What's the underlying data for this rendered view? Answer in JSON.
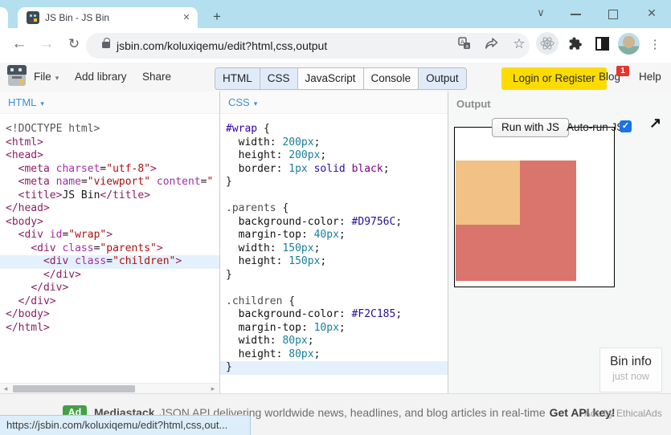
{
  "browser": {
    "tab_title": "JS Bin - JS Bin",
    "url": "jsbin.com/koluxiqemu/edit?html,css,output",
    "status_url": "https://jsbin.com/koluxiqemu/edit?html,css,out..."
  },
  "icons": {
    "caret": "▾",
    "star": "☆",
    "back": "←",
    "forward": "→",
    "reload": "↻",
    "dots": "⋮",
    "chevron": "∨",
    "close": "✕",
    "tab_close": "✕",
    "plus": "+",
    "expand": "↗",
    "check": "✓",
    "scroll_left": "◂",
    "scroll_right": "▸"
  },
  "jsbin": {
    "menu": [
      "File",
      "Add library",
      "Share"
    ],
    "tabs": [
      {
        "label": "HTML",
        "active": true
      },
      {
        "label": "CSS",
        "active": true
      },
      {
        "label": "JavaScript",
        "active": false
      },
      {
        "label": "Console",
        "active": false
      },
      {
        "label": "Output",
        "active": true
      }
    ],
    "login_label": "Login or Register",
    "blog_label": "Blog",
    "blog_badge": "1",
    "help_label": "Help"
  },
  "editors": {
    "html": {
      "title": "HTML",
      "lines": [
        {
          "toks": [
            [
              "meta",
              "<!DOCTYPE html>"
            ]
          ]
        },
        {
          "toks": [
            [
              "tag",
              "<html>"
            ]
          ]
        },
        {
          "toks": [
            [
              "tag",
              "<head>"
            ]
          ]
        },
        {
          "toks": [
            [
              "pl",
              "  "
            ],
            [
              "tag",
              "<meta"
            ],
            [
              "pl",
              " "
            ],
            [
              "attr",
              "charset"
            ],
            [
              "pl",
              "="
            ],
            [
              "str",
              "\"utf-8\""
            ],
            [
              "tag",
              ">"
            ]
          ]
        },
        {
          "toks": [
            [
              "pl",
              "  "
            ],
            [
              "tag",
              "<meta"
            ],
            [
              "pl",
              " "
            ],
            [
              "attr",
              "name"
            ],
            [
              "pl",
              "="
            ],
            [
              "str",
              "\"viewport\""
            ],
            [
              "pl",
              " "
            ],
            [
              "attr",
              "content"
            ],
            [
              "pl",
              "="
            ],
            [
              "str",
              "\""
            ]
          ]
        },
        {
          "toks": [
            [
              "pl",
              "  "
            ],
            [
              "tag",
              "<title>"
            ],
            [
              "pl",
              "JS Bin"
            ],
            [
              "tag",
              "</title>"
            ]
          ]
        },
        {
          "toks": [
            [
              "tag",
              "</head>"
            ]
          ]
        },
        {
          "toks": [
            [
              "tag",
              "<body>"
            ]
          ]
        },
        {
          "toks": [
            [
              "pl",
              "  "
            ],
            [
              "tag",
              "<div"
            ],
            [
              "pl",
              " "
            ],
            [
              "attr",
              "id"
            ],
            [
              "pl",
              "="
            ],
            [
              "str",
              "\"wrap\""
            ],
            [
              "tag",
              ">"
            ]
          ]
        },
        {
          "toks": [
            [
              "pl",
              "    "
            ],
            [
              "tag",
              "<div"
            ],
            [
              "pl",
              " "
            ],
            [
              "attr",
              "class"
            ],
            [
              "pl",
              "="
            ],
            [
              "str",
              "\"parents\""
            ],
            [
              "tag",
              ">"
            ]
          ]
        },
        {
          "hl": true,
          "toks": [
            [
              "pl",
              "      "
            ],
            [
              "tag",
              "<div"
            ],
            [
              "pl",
              " "
            ],
            [
              "attr",
              "class"
            ],
            [
              "pl",
              "="
            ],
            [
              "str",
              "\"children\""
            ],
            [
              "tag",
              ">"
            ]
          ]
        },
        {
          "toks": [
            [
              "pl",
              "      "
            ],
            [
              "tag",
              "</div>"
            ]
          ]
        },
        {
          "toks": [
            [
              "pl",
              "    "
            ],
            [
              "tag",
              "</div>"
            ]
          ]
        },
        {
          "toks": [
            [
              "pl",
              "  "
            ],
            [
              "tag",
              "</div>"
            ]
          ]
        },
        {
          "toks": [
            [
              "tag",
              "</body>"
            ]
          ]
        },
        {
          "toks": [
            [
              "tag",
              "</html>"
            ]
          ]
        }
      ]
    },
    "css": {
      "title": "CSS",
      "lines": [
        {
          "toks": [
            [
              "sel",
              "#wrap"
            ],
            [
              "pl",
              " {"
            ]
          ]
        },
        {
          "toks": [
            [
              "pl",
              "  "
            ],
            [
              "prop",
              "width"
            ],
            [
              "pl",
              ": "
            ],
            [
              "num",
              "200px"
            ],
            [
              "pl",
              ";"
            ]
          ]
        },
        {
          "toks": [
            [
              "pl",
              "  "
            ],
            [
              "prop",
              "height"
            ],
            [
              "pl",
              ": "
            ],
            [
              "num",
              "200px"
            ],
            [
              "pl",
              ";"
            ]
          ]
        },
        {
          "toks": [
            [
              "pl",
              "  "
            ],
            [
              "prop",
              "border"
            ],
            [
              "pl",
              ": "
            ],
            [
              "num",
              "1px"
            ],
            [
              "pl",
              " "
            ],
            [
              "atom",
              "solid"
            ],
            [
              "pl",
              " "
            ],
            [
              "kw",
              "black"
            ],
            [
              "pl",
              ";"
            ]
          ]
        },
        {
          "toks": [
            [
              "pl",
              "}"
            ]
          ]
        },
        {
          "toks": []
        },
        {
          "toks": [
            [
              "qual",
              ".parents"
            ],
            [
              "pl",
              " {"
            ]
          ]
        },
        {
          "toks": [
            [
              "pl",
              "  "
            ],
            [
              "prop",
              "background-color"
            ],
            [
              "pl",
              ": "
            ],
            [
              "atom",
              "#D9756C"
            ],
            [
              "pl",
              ";"
            ]
          ]
        },
        {
          "toks": [
            [
              "pl",
              "  "
            ],
            [
              "prop",
              "margin-top"
            ],
            [
              "pl",
              ": "
            ],
            [
              "num",
              "40px"
            ],
            [
              "pl",
              ";"
            ]
          ]
        },
        {
          "toks": [
            [
              "pl",
              "  "
            ],
            [
              "prop",
              "width"
            ],
            [
              "pl",
              ": "
            ],
            [
              "num",
              "150px"
            ],
            [
              "pl",
              ";"
            ]
          ]
        },
        {
          "toks": [
            [
              "pl",
              "  "
            ],
            [
              "prop",
              "height"
            ],
            [
              "pl",
              ": "
            ],
            [
              "num",
              "150px"
            ],
            [
              "pl",
              ";"
            ]
          ]
        },
        {
          "toks": [
            [
              "pl",
              "}"
            ]
          ]
        },
        {
          "toks": []
        },
        {
          "toks": [
            [
              "qual",
              ".children"
            ],
            [
              "pl",
              " {"
            ]
          ]
        },
        {
          "toks": [
            [
              "pl",
              "  "
            ],
            [
              "prop",
              "background-color"
            ],
            [
              "pl",
              ": "
            ],
            [
              "atom",
              "#F2C185"
            ],
            [
              "pl",
              ";"
            ]
          ]
        },
        {
          "toks": [
            [
              "pl",
              "  "
            ],
            [
              "prop",
              "margin-top"
            ],
            [
              "pl",
              ": "
            ],
            [
              "num",
              "10px"
            ],
            [
              "pl",
              ";"
            ]
          ]
        },
        {
          "toks": [
            [
              "pl",
              "  "
            ],
            [
              "prop",
              "width"
            ],
            [
              "pl",
              ": "
            ],
            [
              "num",
              "80px"
            ],
            [
              "pl",
              ";"
            ]
          ]
        },
        {
          "toks": [
            [
              "pl",
              "  "
            ],
            [
              "prop",
              "height"
            ],
            [
              "pl",
              ": "
            ],
            [
              "num",
              "80px"
            ],
            [
              "pl",
              ";"
            ]
          ]
        },
        {
          "hl": true,
          "toks": [
            [
              "pl",
              "}"
            ]
          ]
        }
      ]
    }
  },
  "output": {
    "title": "Output",
    "run_button": "Run with JS",
    "autorun_label": "Auto-run JS",
    "autorun_checked": true,
    "bin_info": {
      "title": "Bin info",
      "time": "just now"
    },
    "boxes": {
      "wrap_border": "#000000",
      "parents_color": "#D9756C",
      "children_color": "#F2C185"
    }
  },
  "ad": {
    "badge": "Ad",
    "sponsor": "Mediastack",
    "text": "JSON API delivering worldwide news, headlines, and blog articles in real-time",
    "cta": "Get API key!",
    "attribution": "Ads by EthicalAds"
  }
}
